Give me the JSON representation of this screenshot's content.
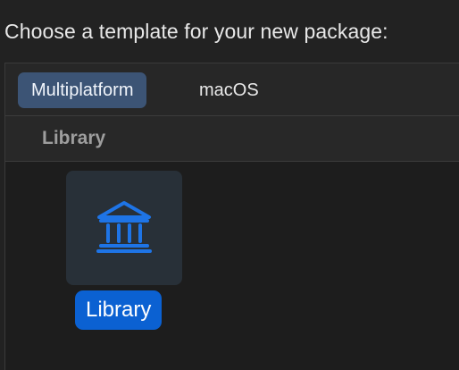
{
  "prompt": "Choose a template for your new package:",
  "tabs": [
    {
      "label": "Multiplatform",
      "selected": true
    },
    {
      "label": "macOS",
      "selected": false
    }
  ],
  "section": {
    "title": "Library"
  },
  "templates": [
    {
      "label": "Library",
      "icon": "library-columns-icon",
      "selected": true
    }
  ],
  "colors": {
    "accent": "#0b61d2",
    "selected_tab": "#3c5475",
    "icon": "#1e74e6"
  }
}
